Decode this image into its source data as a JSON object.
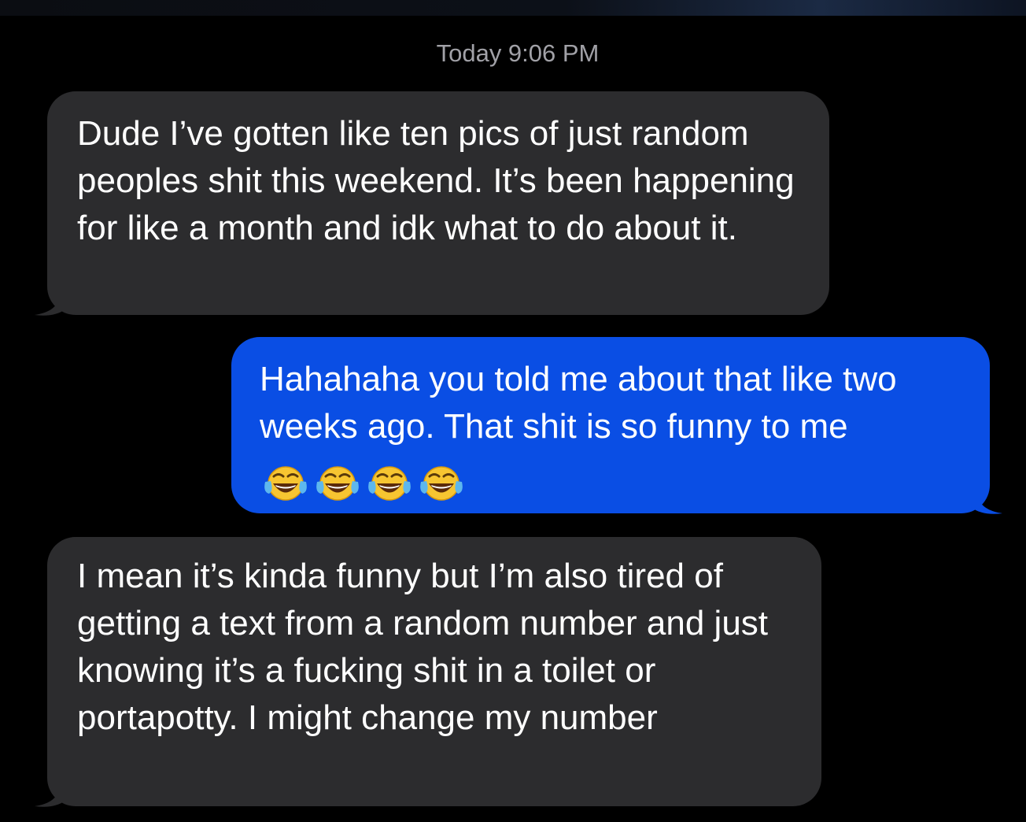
{
  "conversation": {
    "timestamp": "Today 9:06 PM",
    "messages": [
      {
        "direction": "incoming",
        "text": "Dude I’ve gotten like ten pics of just random peoples shit this weekend. It’s been happening for like a month and idk what to do about it."
      },
      {
        "direction": "outgoing",
        "text": "Hahahaha you told me about that like two weeks ago. That shit is so funny to me",
        "emoji": [
          "face-with-tears-of-joy-icon",
          "face-with-tears-of-joy-icon",
          "face-with-tears-of-joy-icon",
          "face-with-tears-of-joy-icon"
        ]
      },
      {
        "direction": "incoming",
        "text": "I mean it’s kinda funny but I’m also tired of getting a text from a random number and just knowing it’s a fucking shit in a toilet or portapotty. I might change my number"
      }
    ]
  },
  "colors": {
    "background": "#000000",
    "incoming_bubble": "#2c2c2e",
    "outgoing_bubble": "#0a4ee4",
    "timestamp_text": "#a1a1a7"
  }
}
